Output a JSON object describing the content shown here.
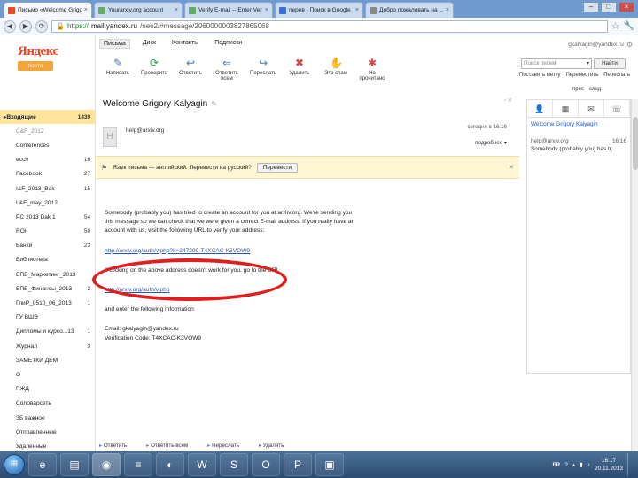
{
  "browser": {
    "tabs": [
      {
        "title": "Письмо «Welcome Grigo",
        "favicon_color": "#e42",
        "active": true
      },
      {
        "title": "Yourarxiv.org account",
        "favicon_color": "#6a6",
        "active": false
      },
      {
        "title": "Verify E-mail -- Enter Verif",
        "favicon_color": "#6a6",
        "active": false
      },
      {
        "title": "перев - Поиск в Google",
        "favicon_color": "#3a6fd6",
        "active": false
      },
      {
        "title": "Добро пожаловать на ...",
        "favicon_color": "#888",
        "active": false
      }
    ],
    "url_secure": "https://",
    "url_host": "mail.yandex.ru",
    "url_path": "/neo2/#message/2060000003827865068"
  },
  "logo": {
    "text": "Яндекс",
    "badge": "почта"
  },
  "folders": [
    {
      "name": "Входящие",
      "count": "1439",
      "selected": true,
      "dim": false
    },
    {
      "name": "C&F_2012",
      "count": "",
      "selected": false,
      "dim": true
    },
    {
      "name": "Conferences",
      "count": "",
      "selected": false,
      "dim": false
    },
    {
      "name": "ecch",
      "count": "16",
      "selected": false,
      "dim": false
    },
    {
      "name": "Facebook",
      "count": "27",
      "selected": false,
      "dim": false
    },
    {
      "name": "I&F_2013_Bak",
      "count": "15",
      "selected": false,
      "dim": false
    },
    {
      "name": "L&E_may_2012",
      "count": "",
      "selected": false,
      "dim": false
    },
    {
      "name": "PC 2013 Dak 1",
      "count": "54",
      "selected": false,
      "dim": false
    },
    {
      "name": "ROI",
      "count": "50",
      "selected": false,
      "dim": false
    },
    {
      "name": "Банки",
      "count": "23",
      "selected": false,
      "dim": false
    },
    {
      "name": "Библиотека",
      "count": "",
      "selected": false,
      "dim": false
    },
    {
      "name": "ВПБ_Маркетинг_2013",
      "count": "",
      "selected": false,
      "dim": false
    },
    {
      "name": "ВПБ_Финансы_2013",
      "count": "2",
      "selected": false,
      "dim": false
    },
    {
      "name": "ГлиР_0510_06_2013",
      "count": "1",
      "selected": false,
      "dim": false
    },
    {
      "name": "ГУ ВШЭ",
      "count": "",
      "selected": false,
      "dim": false
    },
    {
      "name": "Дипломы и курсо...13",
      "count": "1",
      "selected": false,
      "dim": false
    },
    {
      "name": "Журнал",
      "count": "3",
      "selected": false,
      "dim": false
    },
    {
      "name": "ЗАМЕТКИ ДЕМ",
      "count": "",
      "selected": false,
      "dim": false
    },
    {
      "name": "О",
      "count": "",
      "selected": false,
      "dim": false
    },
    {
      "name": "РЖД",
      "count": "",
      "selected": false,
      "dim": false
    },
    {
      "name": "Соловарсеть",
      "count": "",
      "selected": false,
      "dim": false
    },
    {
      "name": "ЗБ важное",
      "count": "",
      "selected": false,
      "dim": false
    },
    {
      "name": "Отправленные",
      "count": "",
      "selected": false,
      "dim": false
    },
    {
      "name": "Удаленные",
      "count": "",
      "selected": false,
      "dim": false
    }
  ],
  "toolbar": {
    "tabs": [
      "Письма",
      "Диск",
      "Контакты",
      "Подписки"
    ],
    "actions": [
      {
        "label": "Написать",
        "icon": "compose-icon",
        "glyph": "✎",
        "cls": "compose"
      },
      {
        "label": "Проверить",
        "icon": "refresh-icon",
        "glyph": "⟳",
        "cls": "check"
      },
      {
        "label": "Ответить",
        "icon": "reply-icon",
        "glyph": "↩",
        "cls": "reply"
      },
      {
        "label": "Ответить всем",
        "icon": "reply-all-icon",
        "glyph": "⇐",
        "cls": "replyall"
      },
      {
        "label": "Переслать",
        "icon": "forward-icon",
        "glyph": "↪",
        "cls": "fwd"
      },
      {
        "label": "Удалить",
        "icon": "delete-icon",
        "glyph": "✖",
        "cls": "del"
      },
      {
        "label": "Это спам",
        "icon": "spam-hand-icon",
        "glyph": "✋",
        "cls": "like"
      },
      {
        "label": "Не прочитано",
        "icon": "unread-icon",
        "glyph": "✱",
        "cls": "spam"
      }
    ]
  },
  "rightbar": {
    "account": "gkalyagin@yandex.ru",
    "search_placeholder": "Поиск писем",
    "find_label": "Найти",
    "links_row1": [
      "Поставить метку",
      "Переместить",
      "Переслать"
    ],
    "links_row2": [
      "прес",
      "след."
    ]
  },
  "message": {
    "subject": "Welcome Grigory Kalyagin",
    "from": "help@arxiv.org",
    "when": "сегодня в 16:16",
    "more": "подробнее ▾",
    "body_p1": "Somebody (probably you) has tried to create an account for you at arXiv.org. We're sending you this message so we can check that we were given a correct E-mail address. If you really have an account with us, visit the following URL to verify your address:",
    "verify_url": "http://arxiv.org/auth/v.php?k=247209-T4XCAC-K3VOW9",
    "body_p2": "If clicking on the above address doesn't work for you, go to the URL",
    "auth_url": "http://arxiv.org/auth/v.php",
    "body_p3": "and enter the following information",
    "email_line": "Email: gkalyagin@yandex.ru",
    "code_line": "Verification Code: T4XCAC-K3VOW9"
  },
  "translate": {
    "text": "Язык письма — английский. Перевести на русский?",
    "button": "Перевести"
  },
  "bottom_actions": [
    "Ответить",
    "Ответить всем",
    "Переслать",
    "Удалить"
  ],
  "sidepane": {
    "tabs": [
      "person-icon",
      "calendar-icon",
      "mail-icon",
      "phone-icon"
    ],
    "thread_title": "Welcome Grigory Kalyagin",
    "thread_from": "help@arxiv.org",
    "thread_time": "16:16",
    "thread_snippet": "Somebody (probably you) has tr..."
  },
  "taskbar": {
    "apps": [
      "ie-icon",
      "folder-icon",
      "chrome-icon",
      "notepad-icon",
      "firefox-icon",
      "word-icon",
      "skype-icon",
      "outlook-icon",
      "powerpoint-icon",
      "picture-icon"
    ],
    "lang": "FR",
    "time": "16:17",
    "date": "20.11.2013"
  },
  "colors": {
    "accent": "#e42",
    "highlight": "#fde39b",
    "annotation": "#e11d1d"
  }
}
